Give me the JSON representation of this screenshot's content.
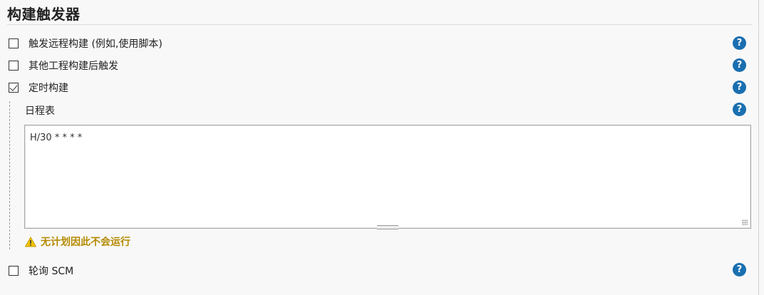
{
  "section": {
    "title": "构建触发器"
  },
  "options": [
    {
      "label": "触发远程构建 (例如,使用脚本)",
      "checked": false
    },
    {
      "label": "其他工程构建后触发",
      "checked": false
    },
    {
      "label": "定时构建",
      "checked": true
    }
  ],
  "schedule": {
    "label": "日程表",
    "value": "H/30 * * * *",
    "warning": "无计划因此不会运行"
  },
  "poll_scm": {
    "label": "轮询 SCM",
    "checked": false
  },
  "help": {
    "glyph": "?"
  },
  "colors": {
    "help_icon": "#1a6fb0",
    "warning_text": "#b58a00"
  }
}
